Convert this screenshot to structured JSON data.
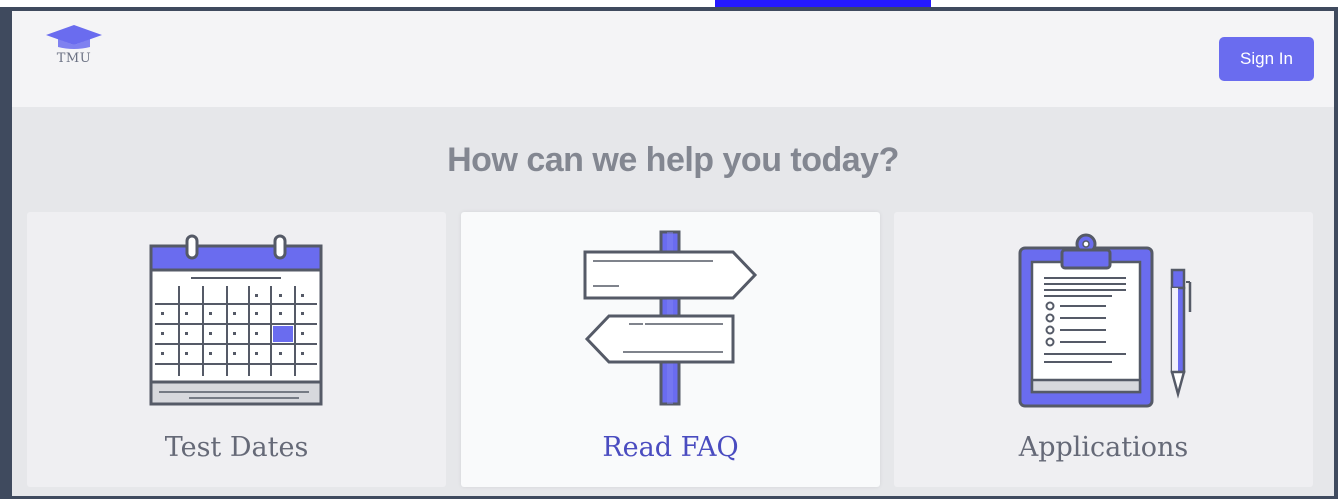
{
  "header": {
    "logo_text": "TMU",
    "sign_in_label": "Sign In"
  },
  "main": {
    "headline": "How can we help you today?",
    "cards": [
      {
        "label": "Test Dates",
        "icon": "calendar-icon"
      },
      {
        "label": "Read FAQ",
        "icon": "signpost-icon",
        "selected": true
      },
      {
        "label": "Applications",
        "icon": "clipboard-icon"
      }
    ]
  },
  "colors": {
    "accent": "#6a6cef",
    "frame": "#3f4a5e",
    "link": "#1a0dff",
    "text_muted": "#838791"
  }
}
